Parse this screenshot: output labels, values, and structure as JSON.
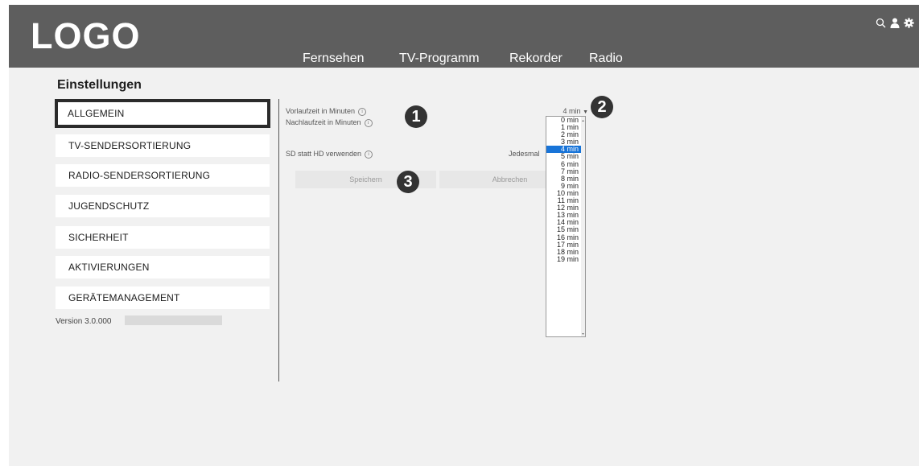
{
  "header": {
    "logo": "LOGO",
    "nav": [
      "Fernsehen",
      "TV-Programm",
      "Rekorder",
      "Radio"
    ],
    "icons": [
      "search-icon",
      "user-icon",
      "gear-icon"
    ]
  },
  "sidebar": {
    "title": "Einstellungen",
    "items": [
      {
        "label": "ALLGEMEIN"
      },
      {
        "label": "TV-SENDERSORTIERUNG"
      },
      {
        "label": "RADIO-SENDERSORTIERUNG"
      },
      {
        "label": "JUGENDSCHUTZ"
      },
      {
        "label": "SICHERHEIT"
      },
      {
        "label": "AKTIVIERUNGEN"
      },
      {
        "label": "GERÄTEMANAGEMENT"
      }
    ],
    "active_index": 0,
    "version": "Version 3.0.000"
  },
  "main": {
    "vorlauf_label": "Vorlaufzeit in Minuten",
    "nachlauf_label": "Nachlaufzeit in Minuten",
    "sd_label": "SD statt HD verwenden",
    "sd_value": "Jedesmal",
    "vorlauf_select": {
      "value": "4 min",
      "options": [
        "0 min",
        "1 min",
        "2 min",
        "3 min",
        "4 min",
        "5 min",
        "6 min",
        "7 min",
        "8 min",
        "9 min",
        "10 min",
        "11 min",
        "12 min",
        "13 min",
        "14 min",
        "15 min",
        "16 min",
        "17 min",
        "18 min",
        "19 min"
      ],
      "selected_index": 4
    },
    "save_label": "Speichern",
    "cancel_label": "Abbrechen"
  },
  "markers": [
    "1",
    "2",
    "3"
  ],
  "colors": {
    "header_bg": "#5e5e5e",
    "selected_option": "#1874d8",
    "marker_bg": "#333333"
  }
}
